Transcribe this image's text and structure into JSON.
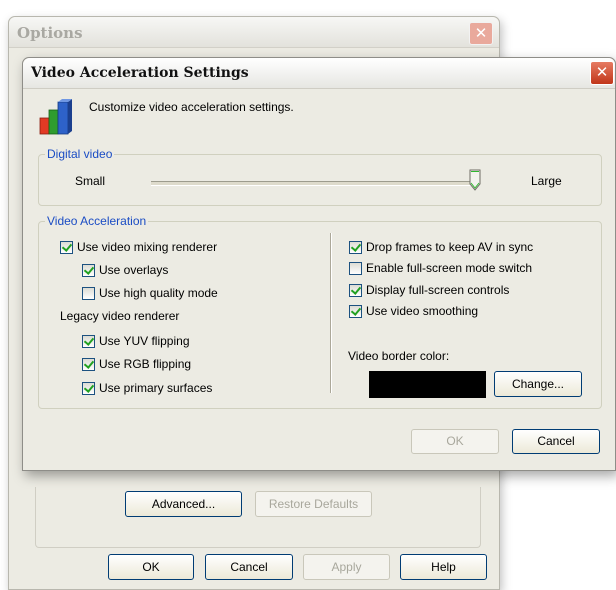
{
  "options_window": {
    "title": "Options",
    "advanced_label": "Advanced...",
    "restore_label": "Restore Defaults",
    "ok_label": "OK",
    "cancel_label": "Cancel",
    "apply_label": "Apply",
    "help_label": "Help"
  },
  "dialog": {
    "title": "Video Acceleration Settings",
    "intro": "Customize video acceleration settings.",
    "digital_video": {
      "legend": "Digital video",
      "min_label": "Small",
      "max_label": "Large",
      "slider_level": 1.0
    },
    "video_acceleration": {
      "legend": "Video Acceleration",
      "use_vmr": {
        "label": "Use video mixing renderer",
        "checked": true
      },
      "use_overlays": {
        "label": "Use overlays",
        "checked": true
      },
      "use_high_quality": {
        "label": "Use high quality mode",
        "checked": false
      },
      "legacy_label": "Legacy video renderer",
      "use_yuv": {
        "label": "Use YUV flipping",
        "checked": true
      },
      "use_rgb": {
        "label": "Use RGB flipping",
        "checked": true
      },
      "use_primary": {
        "label": "Use primary surfaces",
        "checked": true
      },
      "drop_frames": {
        "label": "Drop frames to keep AV in sync",
        "checked": true
      },
      "fullscreen_switch": {
        "label": "Enable full-screen mode switch",
        "checked": false
      },
      "fullscreen_controls": {
        "label": "Display full-screen controls",
        "checked": true
      },
      "video_smoothing": {
        "label": "Use video smoothing",
        "checked": true
      },
      "border_color_label": "Video border color:",
      "border_color": "#000000",
      "change_label": "Change..."
    },
    "ok_label": "OK",
    "cancel_label": "Cancel"
  },
  "icons": {
    "close": "close-icon",
    "settings_chart": "bar-chart-icon",
    "slider": "slider-thumb-icon"
  }
}
